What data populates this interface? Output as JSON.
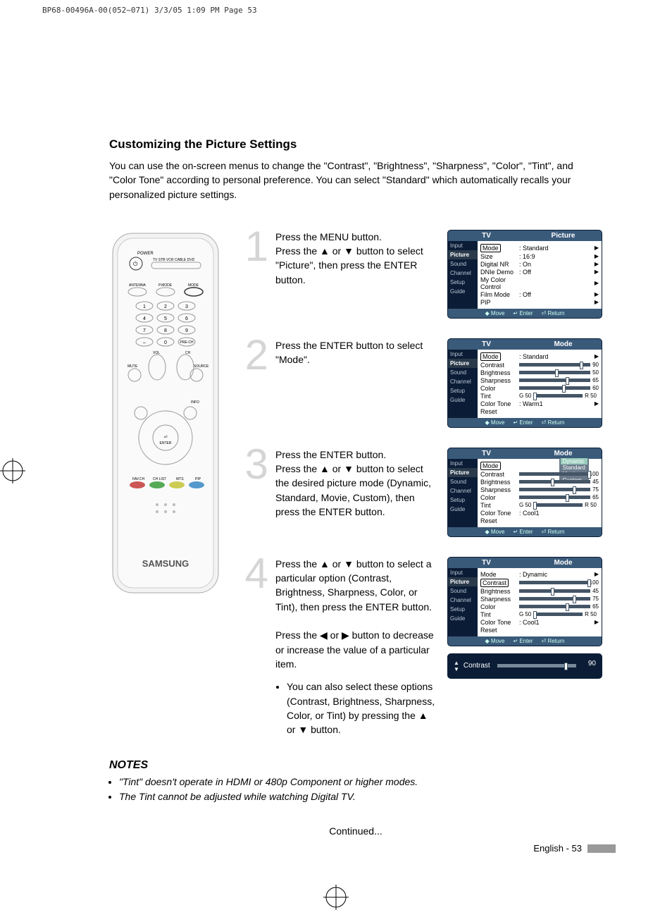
{
  "header_text": "BP68-00496A-00(052~071)  3/3/05  1:09 PM  Page 53",
  "title": "Customizing the Picture Settings",
  "intro": "You can use the on-screen menus to change the \"Contrast\", \"Brightness\", \"Sharpness\", \"Color\", \"Tint\", and \"Color Tone\" according to personal preference. You can select \"Standard\" which automatically recalls your personalized picture settings.",
  "remote": {
    "brand": "SAMSUNG",
    "labels": {
      "power": "POWER",
      "tv": "TV",
      "stb": "STB",
      "vcr": "VCR",
      "cable": "CABLE",
      "dvd": "DVD",
      "antenna": "ANTENNA",
      "pmode": "P.MODE",
      "mode": "MODE",
      "mute": "MUTE",
      "source": "SOURCE",
      "vol": "VOL",
      "ch": "CH",
      "enter": "ENTER",
      "favch": "FAV.CH",
      "chlist": "CH LIST",
      "mts": "MTS",
      "pip": "PIP",
      "info": "INFO",
      "prech": "PRE-CH"
    }
  },
  "steps": [
    {
      "n": "1",
      "text": "Press the MENU button.\nPress the ▲ or ▼ button to select \"Picture\", then press the ENTER button.",
      "osd": {
        "left": "TV",
        "right": "Picture",
        "nav": [
          "Input",
          "Picture",
          "Sound",
          "Channel",
          "Setup",
          "Guide"
        ],
        "nav_sel": 1,
        "rows": [
          [
            "Mode",
            ": Standard",
            "▶",
            "hl"
          ],
          [
            "Size",
            ": 16:9",
            "▶"
          ],
          [
            "Digital NR",
            ": On",
            "▶"
          ],
          [
            "DNIe Demo",
            ": Off",
            "▶"
          ],
          [
            "My Color Control",
            "",
            "▶"
          ],
          [
            "Film Mode",
            ": Off",
            "▶"
          ],
          [
            "PIP",
            "",
            "▶"
          ]
        ],
        "foot": [
          "◆ Move",
          "↵ Enter",
          "⏎ Return"
        ]
      }
    },
    {
      "n": "2",
      "text": "Press the ENTER button to select \"Mode\".",
      "osd": {
        "left": "TV",
        "right": "Mode",
        "nav": [
          "Input",
          "Picture",
          "Sound",
          "Channel",
          "Setup",
          "Guide"
        ],
        "nav_sel": 1,
        "rows": [
          [
            "Mode",
            ": Standard",
            "▶",
            "hl"
          ],
          [
            "Contrast",
            "bar:85",
            "90"
          ],
          [
            "Brightness",
            "bar:50",
            "50"
          ],
          [
            "Sharpness",
            "bar:65",
            "65"
          ],
          [
            "Color",
            "bar:60",
            "60"
          ],
          [
            "Tint",
            "G 50 bar R 50",
            ""
          ],
          [
            "Color Tone",
            ": Warm1",
            "▶"
          ],
          [
            "Reset",
            "",
            ""
          ]
        ],
        "foot": [
          "◆ Move",
          "↵ Enter",
          "⏎ Return"
        ]
      }
    },
    {
      "n": "3",
      "text": "Press the ENTER button.\nPress the ▲ or ▼ button to select the desired picture mode (Dynamic, Standard, Movie, Custom), then press the ENTER button.",
      "osd": {
        "left": "TV",
        "right": "Mode",
        "nav": [
          "Input",
          "Picture",
          "Sound",
          "Channel",
          "Setup",
          "Guide"
        ],
        "nav_sel": 1,
        "dropdown": [
          "Dynamic",
          "Standard",
          "Movie",
          "Custom"
        ],
        "dd_sel": 0,
        "rows": [
          [
            "Mode",
            "",
            "",
            "hl"
          ],
          [
            "Contrast",
            "bar:100",
            "100"
          ],
          [
            "Brightness",
            "bar:45",
            "45"
          ],
          [
            "Sharpness",
            "bar:75",
            "75"
          ],
          [
            "Color",
            "bar:65",
            "65"
          ],
          [
            "Tint",
            "G 50 bar R 50",
            ""
          ],
          [
            "Color Tone",
            ": Cool1",
            ""
          ],
          [
            "Reset",
            "",
            ""
          ]
        ],
        "foot": [
          "◆ Move",
          "↵ Enter",
          "⏎ Return"
        ]
      }
    },
    {
      "n": "4",
      "text": "Press the ▲ or ▼ button to select a particular option (Contrast, Brightness, Sharpness, Color, or Tint), then press the ENTER button.\n\nPress the ◀ or ▶ button to decrease or increase the value of a particular item.",
      "bullet": "You can also select these options (Contrast, Brightness, Sharpness, Color, or Tint) by pressing the ▲ or ▼ button.",
      "osd": {
        "left": "TV",
        "right": "Mode",
        "nav": [
          "Input",
          "Picture",
          "Sound",
          "Channel",
          "Setup",
          "Guide"
        ],
        "nav_sel": 1,
        "rows": [
          [
            "Mode",
            ": Dynamic",
            "▶"
          ],
          [
            "Contrast",
            "bar:100",
            "100",
            "hl"
          ],
          [
            "Brightness",
            "bar:45",
            "45"
          ],
          [
            "Sharpness",
            "bar:75",
            "75"
          ],
          [
            "Color",
            "bar:65",
            "65"
          ],
          [
            "Tint",
            "G 50 bar R 50",
            ""
          ],
          [
            "Color Tone",
            ": Cool1",
            "▶"
          ],
          [
            "Reset",
            "",
            ""
          ]
        ],
        "foot": [
          "◆ Move",
          "↵ Enter",
          "⏎ Return"
        ]
      },
      "slider": {
        "label": "Contrast",
        "value": "90"
      }
    }
  ],
  "notes_heading": "NOTES",
  "notes": [
    "\"Tint\" doesn't operate in HDMI or 480p Component or higher modes.",
    "The Tint cannot be adjusted while watching Digital TV."
  ],
  "continued": "Continued...",
  "footer": "English - 53"
}
